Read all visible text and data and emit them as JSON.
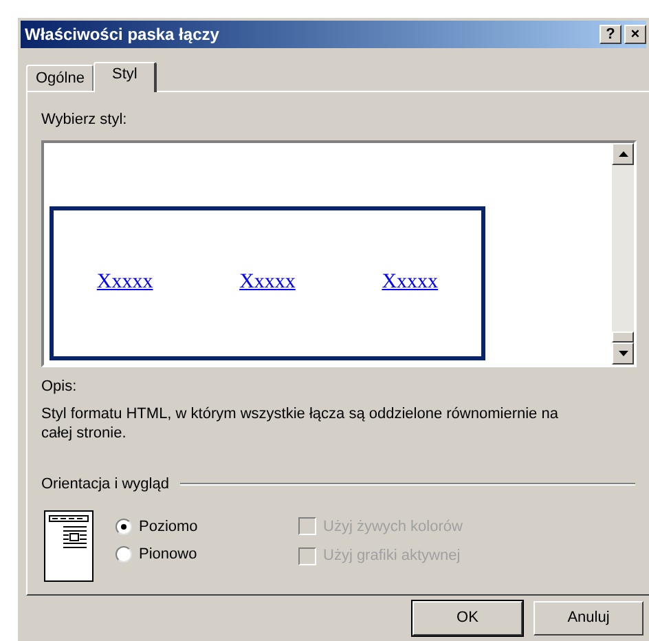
{
  "window": {
    "title": "Właściwości paska łączy",
    "title_buttons": [
      "?",
      "×"
    ]
  },
  "tabs": [
    {
      "label": "Ogólne",
      "selected": false
    },
    {
      "label": "Styl",
      "selected": true
    }
  ],
  "style_list": {
    "label": "Wybierz styl:",
    "items": [
      {
        "selected": true,
        "links": [
          "Xxxxx",
          "Xxxxx",
          "Xxxxx"
        ]
      }
    ]
  },
  "description": {
    "label": "Opis:",
    "text": "Styl formatu HTML, w którym wszystkie łącza są oddzielone równomiernie na całej stronie."
  },
  "orientation_group": {
    "title": "Orientacja i wygląd",
    "radios": [
      {
        "label": "Poziomo",
        "selected": true
      },
      {
        "label": "Pionowo",
        "selected": false
      }
    ],
    "checkboxes": [
      {
        "label": "Użyj żywych kolorów",
        "checked": false,
        "disabled": true
      },
      {
        "label": "Użyj grafiki aktywnej",
        "checked": false,
        "disabled": true
      }
    ]
  },
  "buttons": [
    {
      "label": "OK",
      "default": true
    },
    {
      "label": "Anuluj",
      "default": false
    }
  ]
}
